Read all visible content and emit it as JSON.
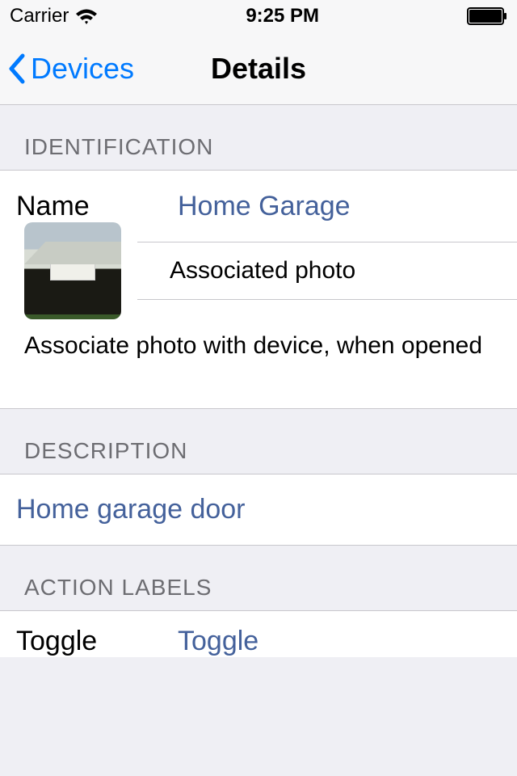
{
  "status": {
    "carrier": "Carrier",
    "time": "9:25 PM"
  },
  "nav": {
    "back_label": "Devices",
    "title": "Details"
  },
  "sections": {
    "identification": {
      "header": "IDENTIFICATION",
      "name_label": "Name",
      "name_value": "Home Garage",
      "photo_label": "Associated photo",
      "footer": "Associate photo with device, when opened"
    },
    "description": {
      "header": "DESCRIPTION",
      "value": "Home garage door"
    },
    "action_labels": {
      "header": "ACTION LABELS",
      "toggle_label": "Toggle",
      "toggle_value": "Toggle"
    }
  }
}
